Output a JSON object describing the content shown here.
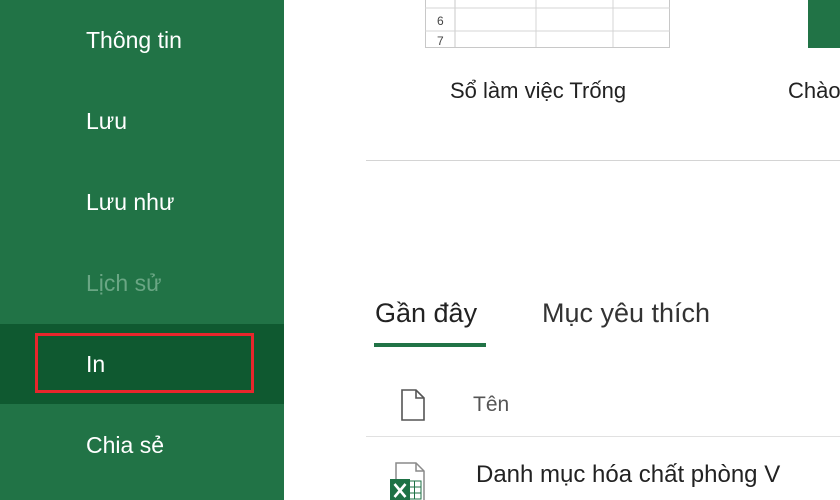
{
  "sidebar": {
    "items": [
      {
        "label": "Thông tin"
      },
      {
        "label": "Lưu"
      },
      {
        "label": "Lưu như"
      },
      {
        "label": "Lịch sử"
      },
      {
        "label": "In"
      },
      {
        "label": "Chia sẻ"
      }
    ]
  },
  "templates": {
    "blank_workbook": "Sổ làm việc Trống",
    "next_template": "Chào",
    "grid_row_numbers": [
      "6",
      "7"
    ]
  },
  "tabs": {
    "recent": "Gần đây",
    "favorites": "Mục yêu thích"
  },
  "file_list": {
    "column_name": "Tên",
    "rows": [
      {
        "name": "Danh mục hóa chất phòng V",
        "icon": "excel-file-icon"
      }
    ]
  },
  "colors": {
    "sidebar_bg": "#217346",
    "selected_bg": "#0f5930",
    "highlight_border": "#e8262c",
    "accent": "#217346"
  }
}
